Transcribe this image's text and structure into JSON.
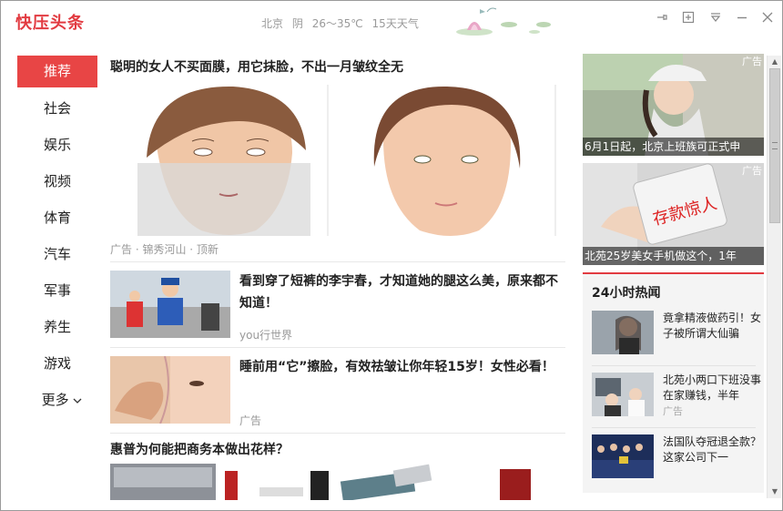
{
  "app": {
    "title": "快压头条"
  },
  "weather": {
    "city": "北京",
    "condition": "阴",
    "temp": "26～35℃",
    "forecast": "15天天气"
  },
  "window_controls": [
    "pin-icon",
    "restore-icon",
    "menu-icon",
    "minimize-icon",
    "close-icon"
  ],
  "colors": {
    "brand": "#e23b41",
    "nav_active": "#e84545"
  },
  "nav": {
    "items": [
      {
        "label": "推荐",
        "active": true
      },
      {
        "label": "社会"
      },
      {
        "label": "娱乐"
      },
      {
        "label": "视频"
      },
      {
        "label": "体育"
      },
      {
        "label": "汽车"
      },
      {
        "label": "军事"
      },
      {
        "label": "养生"
      },
      {
        "label": "游戏"
      },
      {
        "label": "更多"
      }
    ]
  },
  "feed": {
    "headline1": {
      "title": "聪明的女人不买面膜，用它抹脸，不出一月皱纹全无",
      "meta": "广告 · 锦秀河山 · 顶新"
    },
    "items": [
      {
        "title": "看到穿了短裤的李宇春，才知道她的腿这么美，原来都不知道！",
        "source": "you行世界"
      },
      {
        "title": "睡前用“它”擦脸，有效祛皱让你年轻15岁！女性必看！",
        "source": "广告"
      }
    ],
    "headline4": {
      "title": "惠普为何能把商务本做出花样？"
    }
  },
  "right": {
    "ads": [
      {
        "tag": "广告",
        "caption": "6月1日起，北京上班族可正式申"
      },
      {
        "tag": "广告",
        "caption": "北苑25岁美女手机做这个，1年"
      }
    ],
    "hot": {
      "title": "24小时热闻",
      "items": [
        {
          "text": "竟拿精液做药引！女子被所谓大仙骗",
          "source": ""
        },
        {
          "text": "北苑小两口下班没事在家赚钱，半年",
          "source": "广告"
        },
        {
          "text": "法国队夺冠退全款？这家公司下一",
          "source": ""
        }
      ]
    }
  }
}
